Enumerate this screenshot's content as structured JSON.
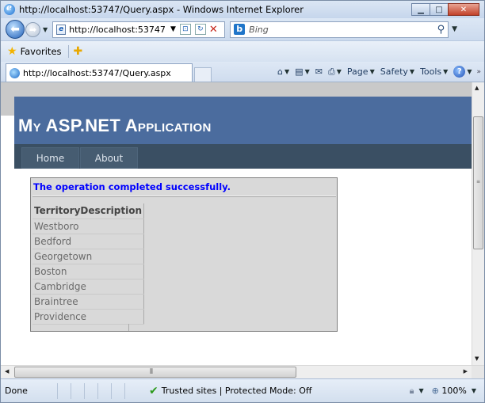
{
  "window": {
    "title": "http://localhost:53747/Query.aspx - Windows Internet Explorer",
    "minimize_label": "▭",
    "maximize_label": "□",
    "close_label": "✕"
  },
  "address_bar": {
    "url": "http://localhost:53747",
    "search_placeholder": "Bing"
  },
  "favorites_bar": {
    "favorites_label": "Favorites"
  },
  "tab": {
    "label": "http://localhost:53747/Query.aspx"
  },
  "command_bar": {
    "page_label": "Page",
    "safety_label": "Safety",
    "tools_label": "Tools"
  },
  "site": {
    "title": "My ASP.NET Application",
    "menu": [
      {
        "label": "Home"
      },
      {
        "label": "About"
      }
    ],
    "status_message": "The operation completed successfully.",
    "grid": {
      "header": "TerritoryDescription",
      "rows": [
        "Westboro",
        "Bedford",
        "Georgetown",
        "Boston",
        "Cambridge",
        "Braintree",
        "Providence"
      ]
    }
  },
  "status_bar": {
    "status": "Done",
    "zone": "Trusted sites | Protected Mode: Off",
    "zoom": "100%"
  },
  "colors": {
    "header_bg": "#4b6c9e",
    "menu_bg": "#3a4f63",
    "success_text": "#0000ff"
  }
}
